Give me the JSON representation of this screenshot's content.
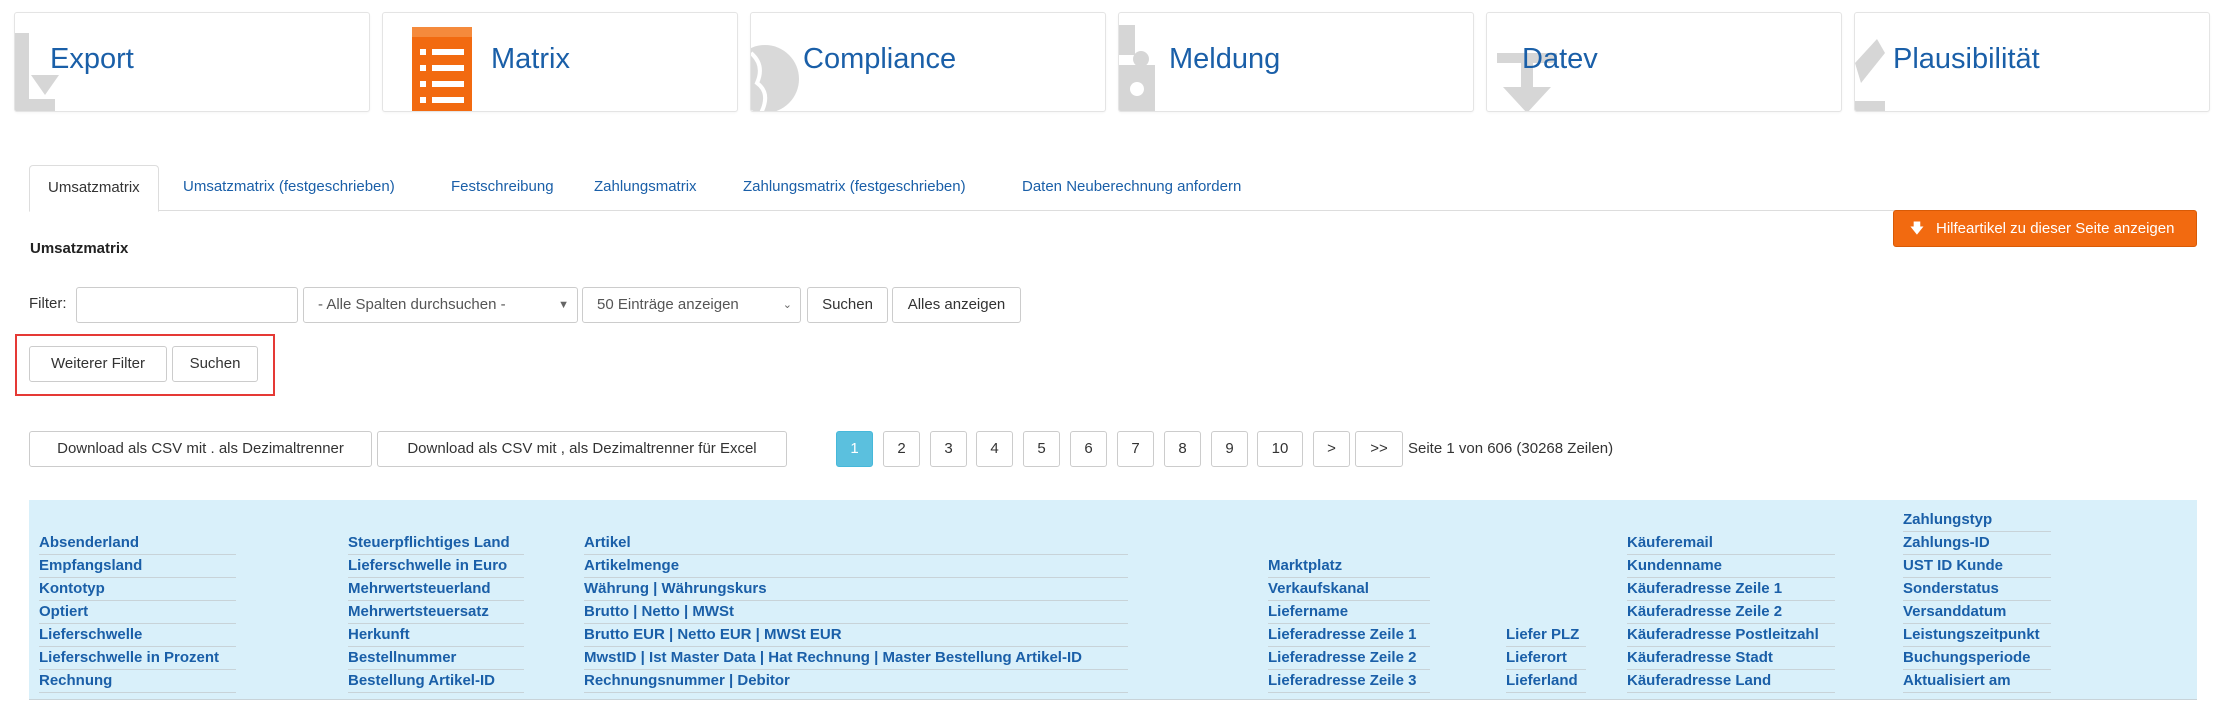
{
  "cards": [
    {
      "label": "Export",
      "icon": "export-icon"
    },
    {
      "label": "Matrix",
      "icon": "list-icon"
    },
    {
      "label": "Compliance",
      "icon": "globe-icon"
    },
    {
      "label": "Meldung",
      "icon": "puzzle-icon"
    },
    {
      "label": "Datev",
      "icon": "download-icon"
    },
    {
      "label": "Plausibilität",
      "icon": "tag-icon"
    }
  ],
  "colors": {
    "accent": "#f26a10",
    "link": "#1a5fa8",
    "header_bg": "#d9f0fa",
    "active_page": "#5bc0de",
    "highlight": "#e53935"
  },
  "tabs": [
    {
      "label": "Umsatzmatrix"
    },
    {
      "label": "Umsatzmatrix (festgeschrieben)"
    },
    {
      "label": "Festschreibung"
    },
    {
      "label": "Zahlungsmatrix"
    },
    {
      "label": "Zahlungsmatrix (festgeschrieben)"
    },
    {
      "label": "Daten Neuberechnung anfordern"
    }
  ],
  "help_button": {
    "label": "Hilfeartikel zu dieser Seite anzeigen",
    "icon": "arrow-down-icon"
  },
  "section_title": "Umsatzmatrix",
  "filter": {
    "label": "Filter:",
    "input_value": "",
    "column_select": "- Alle Spalten durchsuchen -",
    "page_size_select": "50 Einträge anzeigen",
    "search_label": "Suchen",
    "show_all_label": "Alles anzeigen"
  },
  "more_filter": {
    "more_label": "Weiterer Filter",
    "search_label": "Suchen"
  },
  "downloads": {
    "csv_dot": "Download als CSV mit . als Dezimaltrenner",
    "csv_comma": "Download als CSV mit , als Dezimaltrenner für Excel"
  },
  "pagination": {
    "pages": [
      "1",
      "2",
      "3",
      "4",
      "5",
      "6",
      "7",
      "8",
      "9",
      "10"
    ],
    "current": "1",
    "next": ">",
    "last": ">>",
    "info": "Seite 1 von 606 (30268 Zeilen)"
  },
  "columns": {
    "c1": [
      "Absenderland",
      "Empfangsland",
      "Kontotyp",
      "Optiert",
      "Lieferschwelle",
      "Lieferschwelle in Prozent",
      "Rechnung"
    ],
    "c2": [
      "Steuerpflichtiges Land",
      "Lieferschwelle in Euro",
      "Mehrwertsteuerland",
      "Mehrwertsteuersatz",
      "Herkunft",
      "Bestellnummer",
      "Bestellung Artikel-ID"
    ],
    "c3": [
      "Artikel",
      "Artikelmenge",
      "Währung | Währungskurs",
      "Brutto | Netto | MWSt",
      "Brutto EUR | Netto EUR | MWSt EUR",
      "MwstID | Ist Master Data | Hat Rechnung | Master Bestellung Artikel-ID",
      "Rechnungsnummer | Debitor"
    ],
    "c4": [
      "Marktplatz",
      "Verkaufskanal",
      "Liefername",
      "Lieferadresse Zeile 1",
      "Lieferadresse Zeile 2",
      "Lieferadresse Zeile 3"
    ],
    "c5": [
      "Liefer PLZ",
      "Lieferort",
      "Lieferland"
    ],
    "c6": [
      "Käuferemail",
      "Kundenname",
      "Käuferadresse Zeile 1",
      "Käuferadresse Zeile 2",
      "Käuferadresse Postleitzahl",
      "Käuferadresse Stadt",
      "Käuferadresse Land"
    ],
    "c7": [
      "Zahlungstyp",
      "Zahlungs-ID",
      "UST ID Kunde",
      "Sonderstatus",
      "Versanddatum",
      "Leistungszeitpunkt",
      "Buchungsperiode",
      "Aktualisiert am"
    ]
  }
}
